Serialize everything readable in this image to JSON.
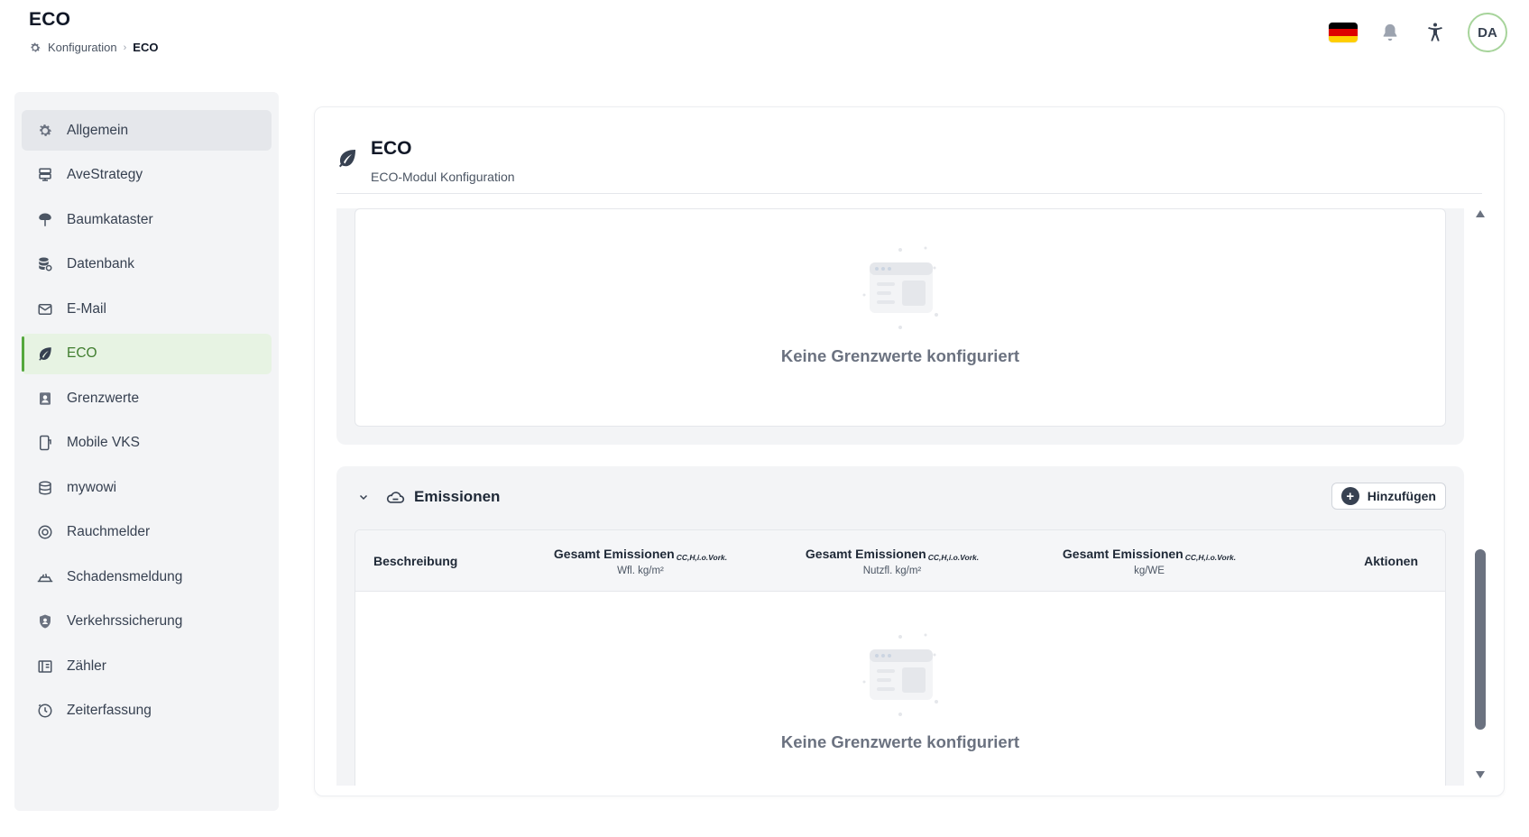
{
  "header": {
    "title": "ECO",
    "breadcrumb": {
      "parent": "Konfiguration",
      "separator": "›",
      "current": "ECO"
    },
    "avatar_initials": "DA",
    "flag_colors": [
      "#000000",
      "#DD0000",
      "#FFCE00"
    ]
  },
  "sidebar": {
    "items": [
      {
        "label": "Allgemein",
        "icon": "gear-icon",
        "state": "hover"
      },
      {
        "label": "AveStrategy",
        "icon": "server-icon",
        "state": ""
      },
      {
        "label": "Baumkataster",
        "icon": "tree-icon",
        "state": ""
      },
      {
        "label": "Datenbank",
        "icon": "database-icon",
        "state": ""
      },
      {
        "label": "E-Mail",
        "icon": "mail-icon",
        "state": ""
      },
      {
        "label": "ECO",
        "icon": "leaf-icon",
        "state": "active"
      },
      {
        "label": "Grenzwerte",
        "icon": "badge-icon",
        "state": ""
      },
      {
        "label": "Mobile VKS",
        "icon": "mobile-icon",
        "state": ""
      },
      {
        "label": "mywowi",
        "icon": "stack-icon",
        "state": ""
      },
      {
        "label": "Rauchmelder",
        "icon": "smoke-detector-icon",
        "state": ""
      },
      {
        "label": "Schadensmeldung",
        "icon": "damage-icon",
        "state": ""
      },
      {
        "label": "Verkehrssicherung",
        "icon": "shield-icon",
        "state": ""
      },
      {
        "label": "Zähler",
        "icon": "meter-icon",
        "state": ""
      },
      {
        "label": "Zeiterfassung",
        "icon": "clock-icon",
        "state": ""
      }
    ]
  },
  "card": {
    "title": "ECO",
    "subtitle": "ECO-Modul Konfiguration"
  },
  "section_top": {
    "empty_text": "Keine Grenzwerte konfiguriert"
  },
  "emissionen": {
    "title": "Emissionen",
    "add_label": "Hinzufügen",
    "columns": [
      {
        "label": "Beschreibung",
        "sub": "",
        "unit": ""
      },
      {
        "label": "Gesamt Emissionen",
        "sub": "CC,H,i.o.Vork.",
        "unit": "Wfl. kg/m²"
      },
      {
        "label": "Gesamt Emissionen",
        "sub": "CC,H,i.o.Vork.",
        "unit": "Nutzfl. kg/m²"
      },
      {
        "label": "Gesamt Emissionen",
        "sub": "CC,H,i.o.Vork.",
        "unit": "kg/WE"
      },
      {
        "label": "Aktionen",
        "sub": "",
        "unit": ""
      }
    ],
    "empty_text": "Keine Grenzwerte konfiguriert"
  },
  "colors": {
    "accent_green": "#55a83d",
    "active_bg": "#e7f3e3"
  }
}
